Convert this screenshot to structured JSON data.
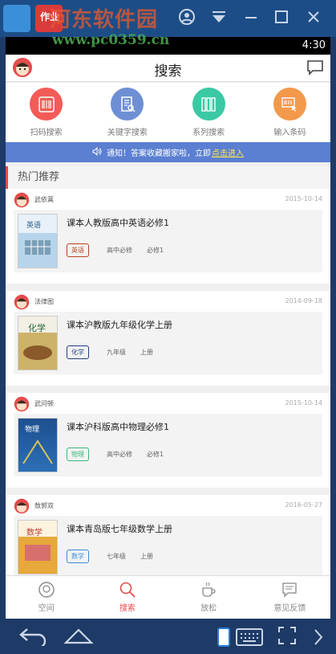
{
  "emulator": {
    "watermark": "河东软件园",
    "app_badge": "作业",
    "url_watermark": "www.pc0359.cn"
  },
  "status_bar": {
    "time": "4:30"
  },
  "header": {
    "title": "搜索"
  },
  "quick_actions": [
    {
      "label": "扫码搜索",
      "icon": "barcode-scan-icon",
      "color": "#f35b57"
    },
    {
      "label": "关键字搜索",
      "icon": "keyword-document-icon",
      "color": "#6f8fd4"
    },
    {
      "label": "系列搜索",
      "icon": "book-series-icon",
      "color": "#3bc9a4"
    },
    {
      "label": "输入条码",
      "icon": "barcode-input-icon",
      "color": "#f3994b"
    }
  ],
  "notice": {
    "text": "通知！答案收藏搬家啦，立即",
    "link": "点击进入"
  },
  "section": {
    "title": "热门推荐"
  },
  "feed": [
    {
      "user": "武依蒿",
      "date": "2015-10-14",
      "title": "课本人教版高中英语必修1",
      "subject": "英语",
      "subject_color": "#b8441f",
      "grade": "高中必修",
      "volume": "必修1",
      "cover": "#b6d4ea"
    },
    {
      "user": "法律图",
      "date": "2014-09-18",
      "title": "课本沪教版九年级化学上册",
      "subject": "化学",
      "subject_color": "#22407a",
      "grade": "九年级",
      "volume": "上册",
      "cover": "#cdb26a"
    },
    {
      "user": "武问顿",
      "date": "2015-10-14",
      "title": "课本沪科版高中物理必修1",
      "subject": "物理",
      "subject_color": "#3bb87a",
      "grade": "高中必修",
      "volume": "必修1",
      "cover": "#2d6fb6"
    },
    {
      "user": "敖郭双",
      "date": "2016-05-27",
      "title": "课本青岛版七年级数学上册",
      "subject": "数学",
      "subject_color": "#3c8ad8",
      "grade": "七年级",
      "volume": "上册",
      "cover": "#e7a83c"
    }
  ],
  "tabbar": [
    {
      "label": "空间",
      "icon": "space-avatar-icon",
      "active": false
    },
    {
      "label": "搜索",
      "icon": "search-icon",
      "active": true
    },
    {
      "label": "放松",
      "icon": "coffee-icon",
      "active": false
    },
    {
      "label": "意见反馈",
      "icon": "feedback-icon",
      "active": false
    }
  ]
}
